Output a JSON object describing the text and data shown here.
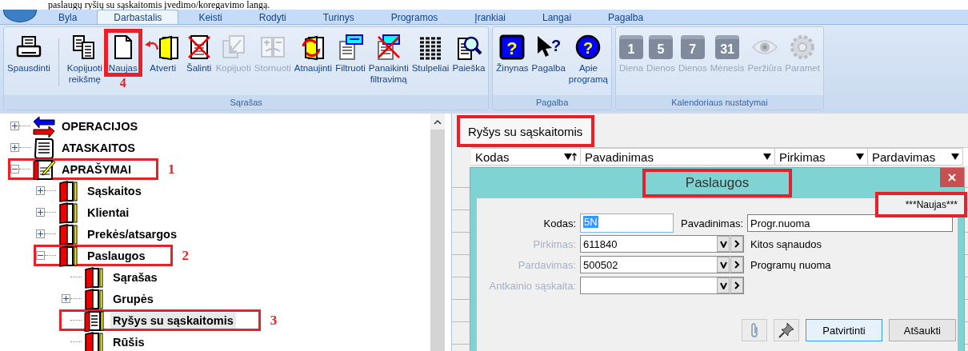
{
  "caption": "paslaugų ryšių su sąskaitomis įvedimo/koregavimo langą.",
  "ribbon": {
    "tabs": [
      {
        "label": "Byla",
        "selected": false
      },
      {
        "label": "Darbastalis",
        "selected": true
      },
      {
        "label": "Keisti",
        "selected": false
      },
      {
        "label": "Rodyti",
        "selected": false
      },
      {
        "label": "Turinys",
        "selected": false
      },
      {
        "label": "Programos",
        "selected": false
      },
      {
        "label": "Įrankiai",
        "selected": false
      },
      {
        "label": "Langai",
        "selected": false
      },
      {
        "label": "Pagalba",
        "selected": false
      }
    ],
    "groups": [
      {
        "title": "Sąrašas",
        "buttons": [
          {
            "kind": "print",
            "lines": [
              "Spausdinti"
            ],
            "disabled": false,
            "marked": false
          },
          {
            "kind": "copy",
            "lines": [
              "Kopijuoti",
              "reikšmę"
            ],
            "disabled": false,
            "marked": false,
            "divider_before": true
          },
          {
            "kind": "new",
            "lines": [
              "Naujas"
            ],
            "disabled": false,
            "marked": true,
            "callout": "4"
          },
          {
            "kind": "open",
            "lines": [
              "Atverti"
            ],
            "disabled": false,
            "marked": false,
            "arrow": true
          },
          {
            "kind": "delete",
            "lines": [
              "Šalinti"
            ],
            "disabled": false,
            "marked": false
          },
          {
            "kind": "duplicate",
            "lines": [
              "Kopijuoti"
            ],
            "disabled": true,
            "marked": false
          },
          {
            "kind": "reverse",
            "lines": [
              "Stornuoti"
            ],
            "disabled": true,
            "marked": false
          },
          {
            "kind": "refresh",
            "lines": [
              "Atnaujinti"
            ],
            "disabled": false,
            "marked": false
          },
          {
            "kind": "filter",
            "lines": [
              "Filtruoti"
            ],
            "disabled": false,
            "marked": false
          },
          {
            "kind": "unfilter",
            "lines": [
              "Panaikinti",
              "filtravimą"
            ],
            "disabled": false,
            "marked": false
          },
          {
            "kind": "columns",
            "lines": [
              "Stulpeliai"
            ],
            "disabled": false,
            "marked": false
          },
          {
            "kind": "search",
            "lines": [
              "Paieška"
            ],
            "disabled": false,
            "marked": false
          }
        ]
      },
      {
        "title": "Pagalba",
        "buttons": [
          {
            "kind": "help",
            "glyph": "?",
            "lines": [
              "Žinynas"
            ],
            "disabled": false,
            "marked": false
          },
          {
            "kind": "pointer-help",
            "glyph": "?",
            "lines": [
              "Pagalba"
            ],
            "disabled": false,
            "marked": false
          },
          {
            "kind": "about",
            "glyph": "?",
            "lines": [
              "Apie",
              "programą"
            ],
            "disabled": false,
            "marked": false
          }
        ]
      },
      {
        "title": "Kalendoriaus nustatymai",
        "buttons": [
          {
            "kind": "calendar",
            "day": "1",
            "lines": [
              "Diena"
            ],
            "disabled": true,
            "marked": false
          },
          {
            "kind": "calendar",
            "day": "5",
            "lines": [
              "Dienos"
            ],
            "disabled": true,
            "marked": false
          },
          {
            "kind": "calendar",
            "day": "7",
            "lines": [
              "Dienos"
            ],
            "disabled": true,
            "marked": false
          },
          {
            "kind": "calendar",
            "day": "31",
            "lines": [
              "Mėnesis"
            ],
            "disabled": true,
            "marked": false
          },
          {
            "kind": "eye",
            "lines": [
              "Peržiūra"
            ],
            "disabled": true,
            "marked": false
          },
          {
            "kind": "gear",
            "lines": [
              "Paramet"
            ],
            "disabled": true,
            "marked": false
          }
        ]
      }
    ]
  },
  "tree": [
    {
      "label": "OPERACIJOS",
      "kind": "operations",
      "expanded": false,
      "selected": false,
      "marked": false
    },
    {
      "label": "ATASKAITOS",
      "kind": "reports",
      "expanded": false,
      "selected": false,
      "marked": false
    },
    {
      "label": "APRAŠYMAI",
      "kind": "descriptions",
      "expanded": true,
      "selected": false,
      "marked": true,
      "callout": "1",
      "children": [
        {
          "label": "Sąskaitos",
          "kind": "book",
          "expanded": false,
          "selected": false,
          "marked": false
        },
        {
          "label": "Klientai",
          "kind": "book",
          "expanded": false,
          "selected": false,
          "marked": false
        },
        {
          "label": "Prekės/atsargos",
          "kind": "book",
          "expanded": false,
          "selected": false,
          "marked": false
        },
        {
          "label": "Paslaugos",
          "kind": "book",
          "expanded": true,
          "selected": false,
          "marked": true,
          "callout": "2",
          "children": [
            {
              "label": "Sąrašas",
              "kind": "book",
              "selected": false,
              "marked": false
            },
            {
              "label": "Grupės",
              "kind": "book",
              "expanded": false,
              "selected": false,
              "marked": false
            },
            {
              "label": "Ryšys su sąskaitomis",
              "kind": "list",
              "selected": true,
              "marked": true,
              "callout": "3"
            },
            {
              "label": "Rūšis",
              "kind": "book",
              "selected": false,
              "marked": false
            }
          ]
        }
      ]
    }
  ],
  "workspace": {
    "tabs": [
      {
        "label": "Ryšys su sąskaitomis",
        "selected": true,
        "marked": true
      }
    ],
    "columns": [
      {
        "label": "Kodas",
        "sorted": true
      },
      {
        "label": "Pavadinimas",
        "sorted": false
      },
      {
        "label": "Pirkimas",
        "sorted": false
      },
      {
        "label": "Pardavimas",
        "sorted": false
      }
    ]
  },
  "dialog": {
    "title": "Paslaugos",
    "title_marked": true,
    "status": "***Naujas***",
    "status_marked": true,
    "code": {
      "label": "Kodas:",
      "value": "5N",
      "value_selected": true
    },
    "name": {
      "label": "Pavadinimas:",
      "value": "Progr.nuoma"
    },
    "lookups": [
      {
        "label": "Pirkimas:",
        "value": "611840",
        "description": "Kitos sąnaudos",
        "dimmed": true
      },
      {
        "label": "Pardavimas:",
        "value": "500502",
        "description": "Programų nuoma",
        "dimmed": true
      },
      {
        "label": "Antkainio sąskaita:",
        "dimmed": true
      }
    ],
    "actions": [
      {
        "kind": "attach"
      },
      {
        "kind": "pin"
      },
      {
        "kind": "text",
        "label": "Patvirtinti",
        "default": true
      },
      {
        "kind": "text",
        "label": "Atšaukti",
        "default": false
      }
    ]
  }
}
